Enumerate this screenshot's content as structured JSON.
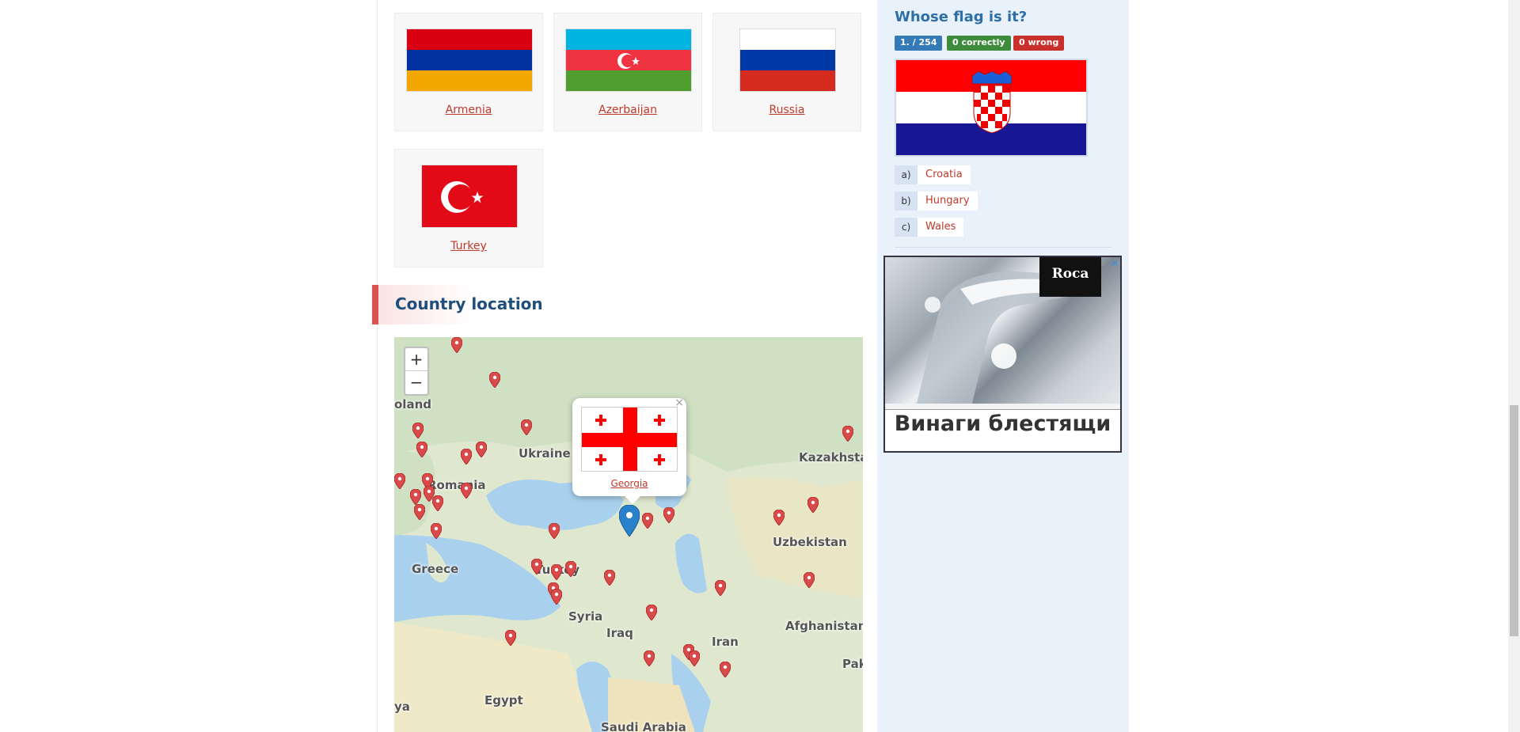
{
  "flags": [
    {
      "name": "Armenia"
    },
    {
      "name": "Azerbaijan"
    },
    {
      "name": "Russia"
    },
    {
      "name": "Turkey"
    }
  ],
  "section": {
    "title": "Country location"
  },
  "map": {
    "zoom_in": "+",
    "zoom_out": "−",
    "labels": [
      "oland",
      "Ukraine",
      "Romania",
      "Kazakhsta",
      "Uzbekistan",
      "Greece",
      "Turkey",
      "Syria",
      "Iraq",
      "Iran",
      "Afghanistan",
      "Egypt",
      "Pak",
      "Saudi Arabia",
      "ya"
    ],
    "popup": {
      "name": "Georgia",
      "close": "×"
    }
  },
  "quiz": {
    "title": "Whose flag is it?",
    "progress": "1. / 254",
    "correct": "0  correctly",
    "wrong": "0  wrong",
    "answers": [
      {
        "letter": "a)",
        "text": "Croatia"
      },
      {
        "letter": "b)",
        "text": "Hungary"
      },
      {
        "letter": "c)",
        "text": "Wales"
      }
    ]
  },
  "ad": {
    "brand": "Roca",
    "text": "Винаги блестящи",
    "close": "✕"
  },
  "colors": {
    "accent": "#c0392b",
    "title_blue": "#1f4f7a",
    "badge_blue": "#337ab7",
    "badge_green": "#3c8c3c",
    "badge_red": "#c9302c"
  }
}
